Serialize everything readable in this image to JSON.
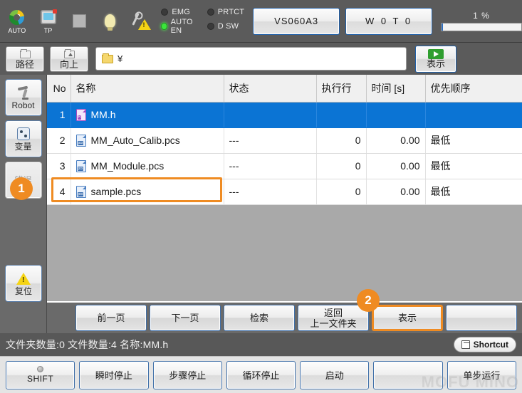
{
  "topbar": {
    "status_icons": [
      {
        "name": "auto-mode-icon",
        "label": "AUTO"
      },
      {
        "name": "teach-pendant-icon",
        "label": "TP"
      },
      {
        "name": "stop-icon",
        "label": ""
      },
      {
        "name": "lamp-icon",
        "label": ""
      },
      {
        "name": "maintenance-warning-icon",
        "label": ""
      }
    ],
    "leds": [
      {
        "label": "EMG",
        "on": false
      },
      {
        "label": "PRTCT",
        "on": false
      },
      {
        "label": "AUTO EN",
        "on": true
      },
      {
        "label": "D SW",
        "on": false
      }
    ],
    "model_button": "VS060A3",
    "program_button": "W 0 T 0",
    "progress_label": "1 %",
    "progress_value": 1
  },
  "pathbar": {
    "path_button": "路径",
    "up_button": "向上",
    "path_value": "¥",
    "show_button": "表示"
  },
  "sidebar": {
    "items": [
      {
        "label": "Robot",
        "icon": "robot-arm-icon",
        "disabled": false
      },
      {
        "label": "变量",
        "icon": "variable-icon",
        "disabled": false
      },
      {
        "label": "错误",
        "icon": "",
        "disabled": true
      }
    ],
    "reset": {
      "label": "复位",
      "icon": "warning-triangle-icon"
    }
  },
  "table": {
    "columns": [
      "No",
      "名称",
      "状态",
      "执行行",
      "时间 [s]",
      "优先顺序"
    ],
    "rows": [
      {
        "no": "1",
        "name": "MM.h",
        "icon": "h-file-icon",
        "state": "",
        "exec_line": "",
        "time": "",
        "priority": "",
        "selected": true
      },
      {
        "no": "2",
        "name": "MM_Auto_Calib.pcs",
        "icon": "pcs-file-icon",
        "state": "---",
        "exec_line": "0",
        "time": "0.00",
        "priority": "最低",
        "selected": false
      },
      {
        "no": "3",
        "name": "MM_Module.pcs",
        "icon": "pcs-file-icon",
        "state": "---",
        "exec_line": "0",
        "time": "0.00",
        "priority": "最低",
        "selected": false
      },
      {
        "no": "4",
        "name": "sample.pcs",
        "icon": "pcs-file-icon",
        "state": "---",
        "exec_line": "0",
        "time": "0.00",
        "priority": "最低",
        "selected": false
      }
    ]
  },
  "function_row": {
    "buttons": [
      {
        "label": "前一页",
        "focused": false
      },
      {
        "label": "下一页",
        "focused": false
      },
      {
        "label": "检索",
        "focused": false
      },
      {
        "label": "返回\n上一文件夹",
        "focused": false
      },
      {
        "label": "表示",
        "focused": true
      },
      {
        "label": "",
        "focused": false
      }
    ]
  },
  "infobar": {
    "text": "文件夹数量:0  文件数量:4  名称:MM.h",
    "shortcut_label": "Shortcut"
  },
  "bottombar": {
    "buttons": [
      {
        "label": "SHIFT",
        "has_dot": true
      },
      {
        "label": "瞬时停止",
        "has_dot": false
      },
      {
        "label": "步骤停止",
        "has_dot": false
      },
      {
        "label": "循环停止",
        "has_dot": false
      },
      {
        "label": "启动",
        "has_dot": false
      },
      {
        "label": "",
        "has_dot": false
      },
      {
        "label": "单步运行",
        "has_dot": false
      }
    ]
  },
  "badges": {
    "one": "1",
    "two": "2"
  },
  "watermark": "MOFU MINO",
  "colors": {
    "accent_orange": "#ef8b22",
    "selection_blue": "#0b74d4",
    "panel_gray": "#5b5b5b",
    "led_on_green": "#3ce53c"
  }
}
